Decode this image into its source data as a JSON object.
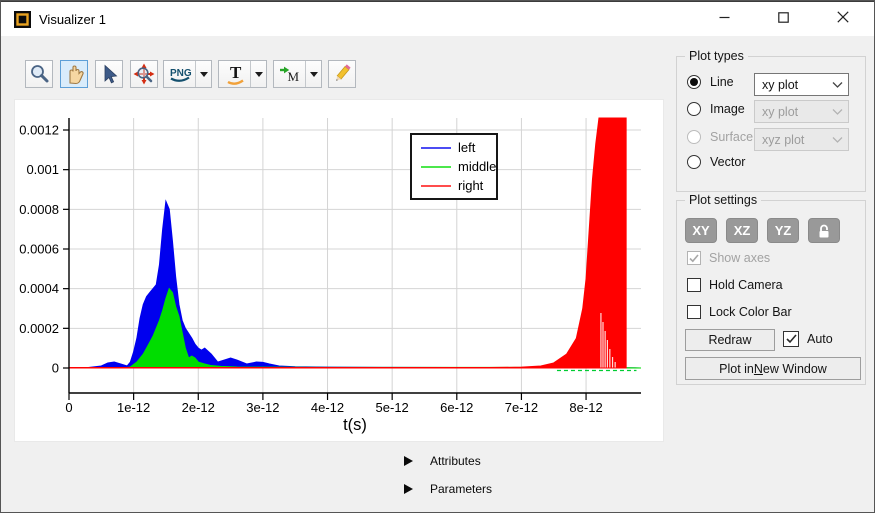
{
  "window": {
    "title": "Visualizer 1"
  },
  "toolbar": {
    "buttons": [
      {
        "id": "zoom",
        "icon": "magnifier-icon",
        "active": false,
        "has_dropdown": false
      },
      {
        "id": "pan",
        "icon": "hand-icon",
        "active": true,
        "has_dropdown": false
      },
      {
        "id": "select",
        "icon": "cursor-arrow-icon",
        "active": false,
        "has_dropdown": false
      },
      {
        "id": "zoom-extents",
        "icon": "magnifier-arrows-icon",
        "active": false,
        "has_dropdown": false
      },
      {
        "id": "export-png",
        "icon": "png-icon",
        "active": false,
        "has_dropdown": true
      },
      {
        "id": "text-annotation",
        "icon": "text-T-icon",
        "active": false,
        "has_dropdown": true
      },
      {
        "id": "export-matlab",
        "icon": "matlab-M-icon",
        "active": false,
        "has_dropdown": true
      },
      {
        "id": "edit",
        "icon": "pencil-icon",
        "active": false,
        "has_dropdown": false
      }
    ],
    "icon_text": {
      "png": "PNG",
      "text_tool": "T",
      "matlab": "M"
    }
  },
  "chart_data": {
    "type": "line",
    "title": "",
    "xlabel": "t(s)",
    "ylabel": "",
    "xlim": [
      0,
      8.85e-12
    ],
    "ylim": [
      0,
      0.00126
    ],
    "grid": true,
    "legend_position": "top-center",
    "legend_entries": [
      "left",
      "middle",
      "right"
    ],
    "x_ticks": {
      "values": [
        0,
        1e-12,
        2e-12,
        3e-12,
        4e-12,
        5e-12,
        6e-12,
        7e-12,
        8e-12
      ],
      "labels": [
        "0",
        "1e-12",
        "2e-12",
        "3e-12",
        "4e-12",
        "5e-12",
        "6e-12",
        "7e-12",
        "8e-12"
      ]
    },
    "y_ticks": {
      "values": [
        0,
        0.0002,
        0.0004,
        0.0006,
        0.0008,
        0.001,
        0.0012
      ],
      "labels": [
        "0",
        "0.0002",
        "0.0004",
        "0.0006",
        "0.0008",
        "0.001",
        "0.0012"
      ]
    },
    "series": [
      {
        "name": "left",
        "color": "#0000ee",
        "style": "filled_envelope",
        "x": [
          0,
          3e-13,
          5e-13,
          6e-13,
          7e-13,
          8e-13,
          9e-13,
          9.5e-13,
          1e-12,
          1.05e-12,
          1.1e-12,
          1.15e-12,
          1.2e-12,
          1.25e-12,
          1.3e-12,
          1.35e-12,
          1.4e-12,
          1.45e-12,
          1.5e-12,
          1.55e-12,
          1.6e-12,
          1.65e-12,
          1.7e-12,
          1.75e-12,
          1.8e-12,
          1.9e-12,
          1.95e-12,
          2e-12,
          2.05e-12,
          2.1e-12,
          2.2e-12,
          2.3e-12,
          2.4e-12,
          2.5e-12,
          2.6e-12,
          2.75e-12,
          2.9e-12,
          3e-12,
          3.1e-12,
          3.25e-12,
          3.5e-12,
          4e-12,
          5e-12,
          6e-12,
          7e-12,
          8e-12,
          8.85e-12
        ],
        "y": [
          0,
          2e-06,
          1e-05,
          2.5e-05,
          3e-05,
          2e-05,
          1e-05,
          3e-05,
          8e-05,
          0.00015,
          0.00025,
          0.00032,
          0.00036,
          0.00038,
          0.0004,
          0.00042,
          0.00052,
          0.0007,
          0.00084,
          0.0008,
          0.00064,
          0.00046,
          0.00032,
          0.00024,
          0.0002,
          0.00015,
          0.00012,
          0.0001,
          9e-05,
          0.0001,
          7e-05,
          3e-05,
          4e-05,
          5e-05,
          4e-05,
          2e-05,
          3e-05,
          2.8e-05,
          2e-05,
          1e-05,
          6e-06,
          4e-06,
          3e-06,
          2e-06,
          2e-06,
          2e-06,
          0
        ]
      },
      {
        "name": "middle",
        "color": "#00dd00",
        "style": "filled_envelope",
        "x": [
          8.5e-13,
          9.5e-13,
          1.05e-12,
          1.1e-12,
          1.15e-12,
          1.2e-12,
          1.25e-12,
          1.3e-12,
          1.35e-12,
          1.4e-12,
          1.45e-12,
          1.5e-12,
          1.55e-12,
          1.6e-12,
          1.65e-12,
          1.7e-12,
          1.75e-12,
          1.8e-12,
          1.85e-12,
          1.9e-12,
          1.95e-12,
          2e-12,
          2.1e-12,
          2.2e-12,
          2.35e-12,
          2.6e-12,
          3e-12,
          4e-12,
          6e-12,
          8e-12,
          8.85e-12
        ],
        "y": [
          0,
          5e-06,
          3e-05,
          5e-05,
          7e-05,
          0.0001,
          0.00013,
          0.00016,
          0.0002,
          0.00024,
          0.00029,
          0.00035,
          0.0004,
          0.00038,
          0.00031,
          0.00026,
          0.00018,
          0.0001,
          5e-05,
          6e-05,
          5e-05,
          3e-05,
          2e-05,
          1.2e-05,
          8e-06,
          5e-06,
          4e-06,
          3e-06,
          3e-06,
          3e-06,
          0
        ]
      },
      {
        "name": "right",
        "color": "#ff0000",
        "style": "filled_envelope_clipped_at_top",
        "x": [
          0,
          6.5e-12,
          7e-12,
          7.3e-12,
          7.5e-12,
          7.7e-12,
          7.85e-12,
          7.95e-12,
          8e-12,
          8.05e-12,
          8.1e-12,
          8.15e-12,
          8.2e-12,
          8.62e-12,
          8.62e-12
        ],
        "y": [
          2e-06,
          2e-06,
          4e-06,
          1e-05,
          2.5e-05,
          7e-05,
          0.00015,
          0.0003,
          0.00045,
          0.0007,
          0.00095,
          0.00113,
          0.00126,
          0.00126,
          0
        ]
      }
    ]
  },
  "plot_types": {
    "title": "Plot types",
    "rows": [
      {
        "label": "Line",
        "selected": true,
        "enabled": true,
        "dropdown": {
          "value": "xy plot",
          "enabled": true
        }
      },
      {
        "label": "Image",
        "selected": false,
        "enabled": true,
        "dropdown": {
          "value": "xy plot",
          "enabled": false
        }
      },
      {
        "label": "Surface",
        "selected": false,
        "enabled": false,
        "dropdown": {
          "value": "xyz plot",
          "enabled": false
        }
      },
      {
        "label": "Vector",
        "selected": false,
        "enabled": true,
        "dropdown": null
      }
    ]
  },
  "plot_settings": {
    "title": "Plot settings",
    "plane_buttons": [
      "XY",
      "XZ",
      "YZ"
    ],
    "lock_button": "aspect-lock",
    "checkboxes": [
      {
        "label": "Show axes",
        "checked": true,
        "enabled": false
      },
      {
        "label": "Hold Camera",
        "checked": false,
        "enabled": true
      },
      {
        "label": "Lock Color Bar",
        "checked": false,
        "enabled": true
      }
    ],
    "redraw_label": "Redraw",
    "auto_label": "Auto",
    "auto_checked": true,
    "new_window": {
      "prefix": "Plot in ",
      "mnemonic": "N",
      "suffix": "ew Window"
    }
  },
  "expanders": {
    "attributes": "Attributes",
    "parameters": "Parameters"
  },
  "colors": {
    "window_bg": "#f0f0f0",
    "titlebar_bg": "#ffffff",
    "plot_bg": "#ffffff",
    "grid": "#d4d4d4",
    "axis": "#000000",
    "selected_tool_bg": "#d9ecfb",
    "selected_tool_border": "#5d9fd7",
    "app_icon_orange": "#e8a220",
    "series_left": "#0000ee",
    "series_middle": "#00dd00",
    "series_right": "#ff0000"
  }
}
